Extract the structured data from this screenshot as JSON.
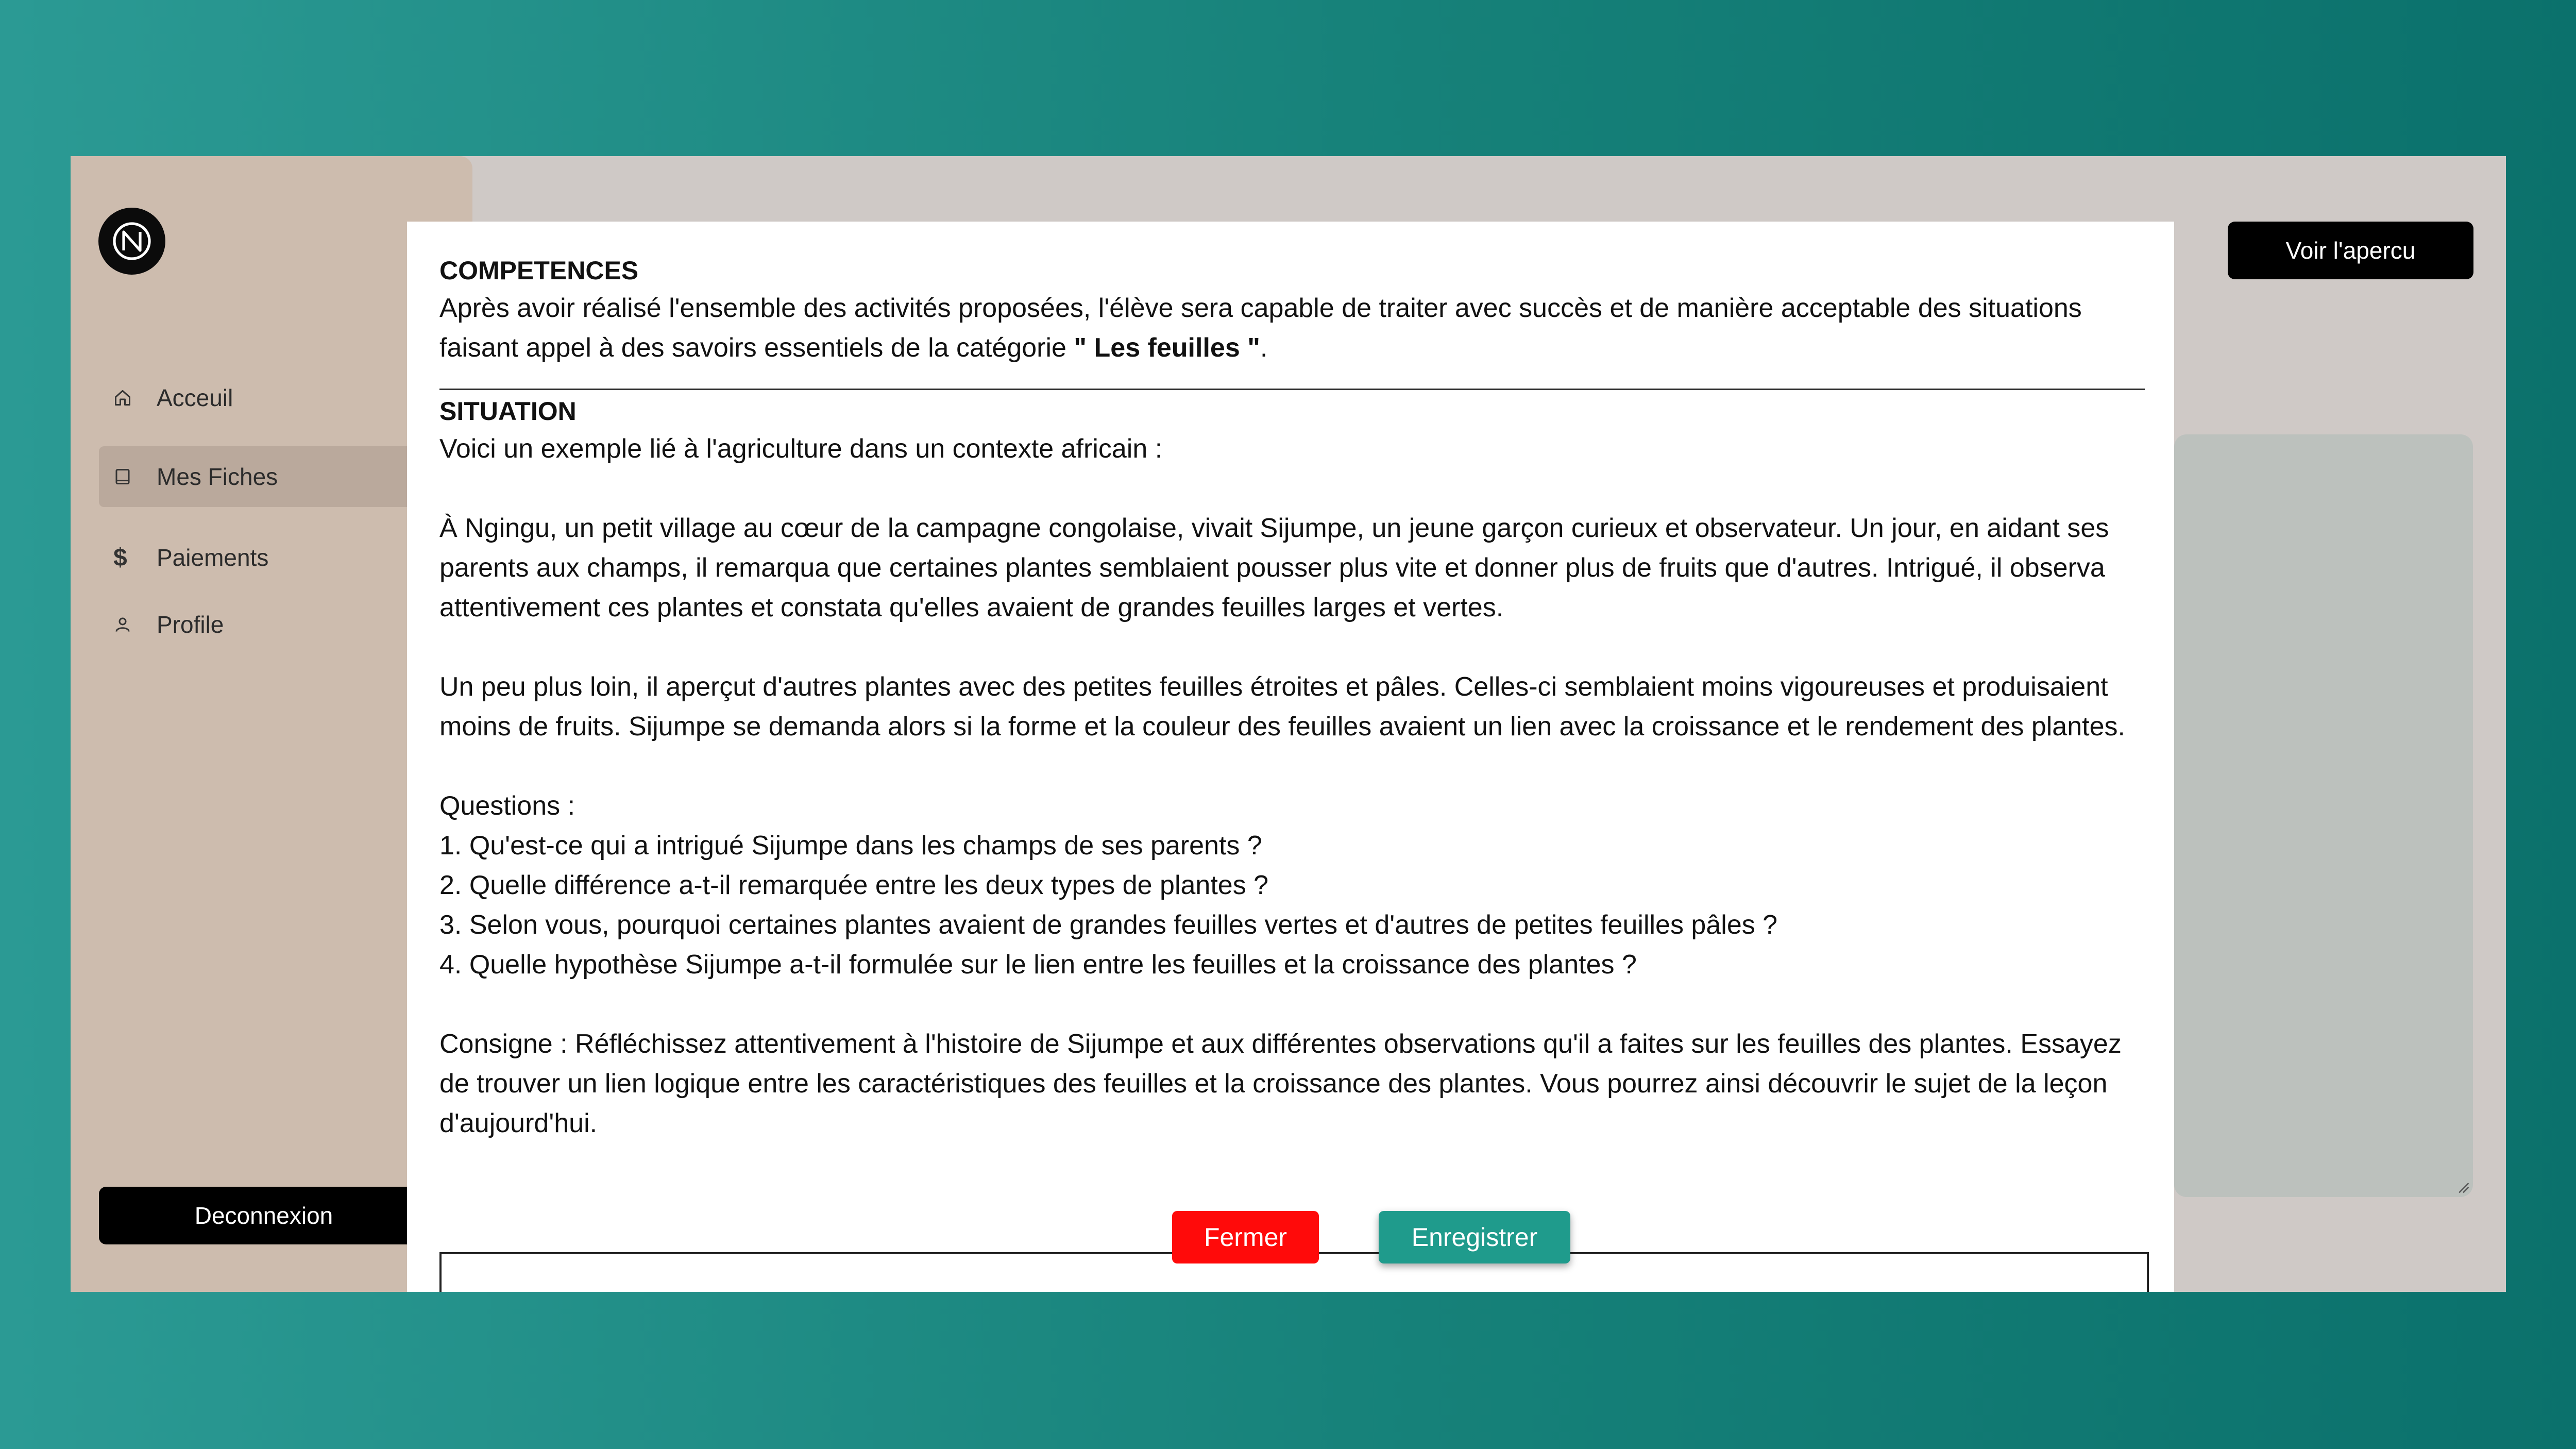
{
  "sidebar": {
    "items": [
      {
        "label": "Acceuil",
        "icon": "home-icon"
      },
      {
        "label": "Mes Fiches",
        "icon": "book-icon",
        "active": true
      },
      {
        "label": "Paiements",
        "icon": "dollar-icon"
      },
      {
        "label": "Profile",
        "icon": "user-icon"
      }
    ],
    "logout_label": "Deconnexion"
  },
  "topbar": {
    "preview_label": "Voir l'apercu"
  },
  "modal": {
    "competences": {
      "title": "COMPETENCES",
      "text_before": "Après avoir réalisé l'ensemble des activités proposées, l'élève sera capable de traiter avec succès et de manière acceptable des situations faisant appel à des savoirs essentiels de la catégorie ",
      "category": "\" Les feuilles \"",
      "text_after": "."
    },
    "situation": {
      "title": "SITUATION",
      "intro": "Voici un exemple lié à l'agriculture dans un contexte africain :",
      "para1": "À Ngingu, un petit village au cœur de la campagne congolaise, vivait Sijumpe, un jeune garçon curieux et observateur. Un jour, en aidant ses parents aux champs, il remarqua que certaines plantes semblaient pousser plus vite et donner plus de fruits que d'autres. Intrigué, il observa attentivement ces plantes et constata qu'elles avaient de grandes feuilles larges et vertes.",
      "para2": "Un peu plus loin, il aperçut d'autres plantes avec des petites feuilles étroites et pâles. Celles-ci semblaient moins vigoureuses et produisaient moins de fruits. Sijumpe se demanda alors si la forme et la couleur des feuilles avaient un lien avec la croissance et le rendement des plantes.",
      "questions_label": "Questions :",
      "questions": [
        "1. Qu'est-ce qui a intrigué Sijumpe dans les champs de ses parents ?",
        "2. Quelle différence a-t-il remarquée entre les deux types de plantes ?",
        "3. Selon vous, pourquoi certaines plantes avaient de grandes feuilles vertes et d'autres de petites feuilles pâles ?",
        "4. Quelle hypothèse Sijumpe a-t-il formulée sur le lien entre les feuilles et la croissance des plantes ?"
      ],
      "consigne": "Consigne : Réfléchissez attentivement à l'histoire de Sijumpe et aux différentes observations qu'il a faites sur les feuilles des plantes. Essayez de trouver un lien logique entre les caractéristiques des feuilles et la croissance des plantes. Vous pourrez ainsi découvrir le sujet de la leçon d'aujourd'hui."
    },
    "close_label": "Fermer",
    "save_label": "Enregistrer"
  },
  "colors": {
    "close_button": "#ff0a0a",
    "save_button": "#1f9b8c",
    "sidebar": "#cdbcae",
    "background_gradient_start": "#2b9a94",
    "background_gradient_end": "#0b716c"
  }
}
